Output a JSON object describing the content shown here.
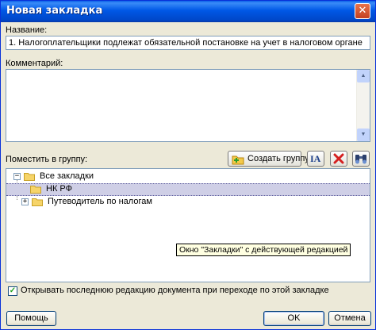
{
  "window": {
    "title": "Новая закладка",
    "close_label": "✕"
  },
  "name": {
    "label": "Название:",
    "value": "1. Налогоплательщики подлежат обязательной постановке на учет в налоговом органе"
  },
  "comment": {
    "label": "Комментарий:",
    "value": ""
  },
  "group": {
    "label": "Поместить в группу:",
    "create_button_label": "Создать группу",
    "rename_button_label": "IA"
  },
  "tree": {
    "items": [
      {
        "label": "Все закладки",
        "expander": "−"
      },
      {
        "label": "НК РФ"
      },
      {
        "label": "Путеводитель по налогам",
        "expander": "+"
      }
    ],
    "tooltip": "Окно \"Закладки\" с действующей редакцией"
  },
  "option": {
    "label": "Открывать последнюю редакцию документа при переходе по этой закладке",
    "checked_mark": "✓"
  },
  "buttons": {
    "help": "Помощь",
    "ok": "OK",
    "cancel": "Отмена"
  },
  "colors": {
    "title_bar": "#0058e6",
    "dialog_bg": "#ece9d8",
    "selection": "#cfcfe6",
    "tooltip_bg": "#ffffe1",
    "delete_icon": "#d42020"
  }
}
